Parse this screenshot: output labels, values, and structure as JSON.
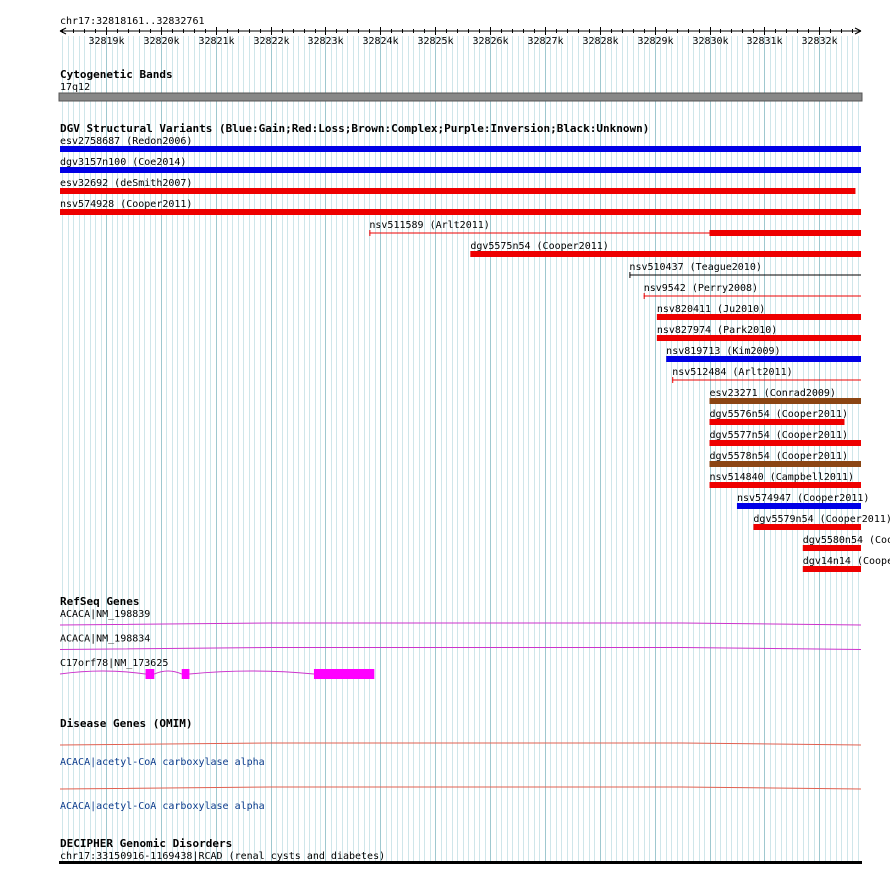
{
  "ruler": {
    "range_label": "chr17:32818161..32832761",
    "start": 32818161,
    "end": 32832761,
    "ticks": [
      "32819k",
      "32820k",
      "32821k",
      "32822k",
      "32823k",
      "32824k",
      "32825k",
      "32826k",
      "32827k",
      "32828k",
      "32829k",
      "32830k",
      "32831k",
      "32832k"
    ]
  },
  "tracks": {
    "cytobands": {
      "title": "Cytogenetic Bands",
      "band": "17q12"
    },
    "dgv": {
      "title": "DGV Structural Variants (Blue:Gain;Red:Loss;Brown:Complex;Purple:Inversion;Black:Unknown)",
      "colors": {
        "gain": "#0000e6",
        "loss": "#ee0000",
        "complex": "#8b4513",
        "inversion": "#800080",
        "unknown": "#000000"
      },
      "variants": [
        {
          "label": "esv2758687 (Redon2006)",
          "type": "gain",
          "start": 32818161,
          "end": 32832761,
          "core_start": 32818161
        },
        {
          "label": "dgv3157n100 (Coe2014)",
          "type": "gain",
          "start": 32818161,
          "end": 32832761,
          "core_start": 32818161
        },
        {
          "label": "esv32692 (deSmith2007)",
          "type": "loss",
          "start": 32818161,
          "end": 32832660,
          "core_start": 32818161
        },
        {
          "label": "nsv574928 (Cooper2011)",
          "type": "loss",
          "start": 32818161,
          "end": 32832761,
          "core_start": 32818161
        },
        {
          "label": "nsv511589 (Arlt2011)",
          "type": "loss",
          "start": 32823800,
          "end": 32832761,
          "core_start": 32830000
        },
        {
          "label": "dgv5575n54 (Cooper2011)",
          "type": "loss",
          "start": 32825640,
          "end": 32832761,
          "core_start": 32825640
        },
        {
          "label": "nsv510437 (Teague2010)",
          "type": "unknown",
          "start": 32828540,
          "end": 32832761,
          "core_start": 32832761
        },
        {
          "label": "nsv9542 (Perry2008)",
          "type": "loss",
          "start": 32828800,
          "end": 32832761,
          "core_start": 32832761
        },
        {
          "label": "nsv820411 (Ju2010)",
          "type": "loss",
          "start": 32829040,
          "end": 32832761,
          "core_start": 32829040
        },
        {
          "label": "nsv827974 (Park2010)",
          "type": "loss",
          "start": 32829040,
          "end": 32832761,
          "core_start": 32829040
        },
        {
          "label": "nsv819713 (Kim2009)",
          "type": "gain",
          "start": 32829210,
          "end": 32832761,
          "core_start": 32829210
        },
        {
          "label": "nsv512484 (Arlt2011)",
          "type": "loss",
          "start": 32829320,
          "end": 32832761,
          "core_start": 32832761
        },
        {
          "label": "esv23271 (Conrad2009)",
          "type": "complex",
          "start": 32830000,
          "end": 32832761,
          "core_start": 32830000
        },
        {
          "label": "dgv5576n54 (Cooper2011)",
          "type": "loss",
          "start": 32830000,
          "end": 32832460,
          "core_start": 32830000
        },
        {
          "label": "dgv5577n54 (Cooper2011)",
          "type": "loss",
          "start": 32830000,
          "end": 32832761,
          "core_start": 32830000
        },
        {
          "label": "dgv5578n54 (Cooper2011)",
          "type": "complex",
          "start": 32830000,
          "end": 32832761,
          "core_start": 32830000
        },
        {
          "label": "nsv514840 (Campbell2011)",
          "type": "loss",
          "start": 32830000,
          "end": 32832761,
          "core_start": 32830000
        },
        {
          "label": "nsv574947 (Cooper2011)",
          "type": "gain",
          "start": 32830500,
          "end": 32832761,
          "core_start": 32830500
        },
        {
          "label": "dgv5579n54 (Cooper2011)",
          "type": "loss",
          "start": 32830800,
          "end": 32832761,
          "core_start": 32830800
        },
        {
          "label": "dgv5580n54 (Coo",
          "type": "loss",
          "start": 32831700,
          "end": 32832761,
          "core_start": 32831700
        },
        {
          "label": "dgv14n14 (Coope",
          "type": "loss",
          "start": 32831700,
          "end": 32832761,
          "core_start": 32831700
        }
      ]
    },
    "refseq": {
      "title": "RefSeq Genes",
      "intron_color": "#cc33cc",
      "exon_color": "#ff00ff",
      "genes": [
        {
          "label": "ACACA|NM_198839",
          "start": 32818161,
          "end": 32832761,
          "exons": []
        },
        {
          "label": "ACACA|NM_198834",
          "start": 32818161,
          "end": 32832761,
          "exons": []
        },
        {
          "label": "C17orf78|NM_173625",
          "start": 32818161,
          "end": 32823900,
          "exons": [
            [
              32819720,
              32819880
            ],
            [
              32820380,
              32820520
            ],
            [
              32822790,
              32823890
            ]
          ]
        }
      ]
    },
    "omim": {
      "title": "Disease Genes (OMIM)",
      "line_color": "#e06050",
      "entries": [
        {
          "label": "ACACA|acetyl-CoA carboxylase alpha",
          "start": 32818161,
          "end": 32832761
        },
        {
          "label": "ACACA|acetyl-CoA carboxylase alpha",
          "start": 32818161,
          "end": 32832761
        }
      ]
    },
    "decipher": {
      "title": "DECIPHER Genomic Disorders",
      "entries": [
        {
          "label": "chr17:33150916-1169438|RCAD (renal cysts and diabetes)"
        }
      ]
    }
  }
}
